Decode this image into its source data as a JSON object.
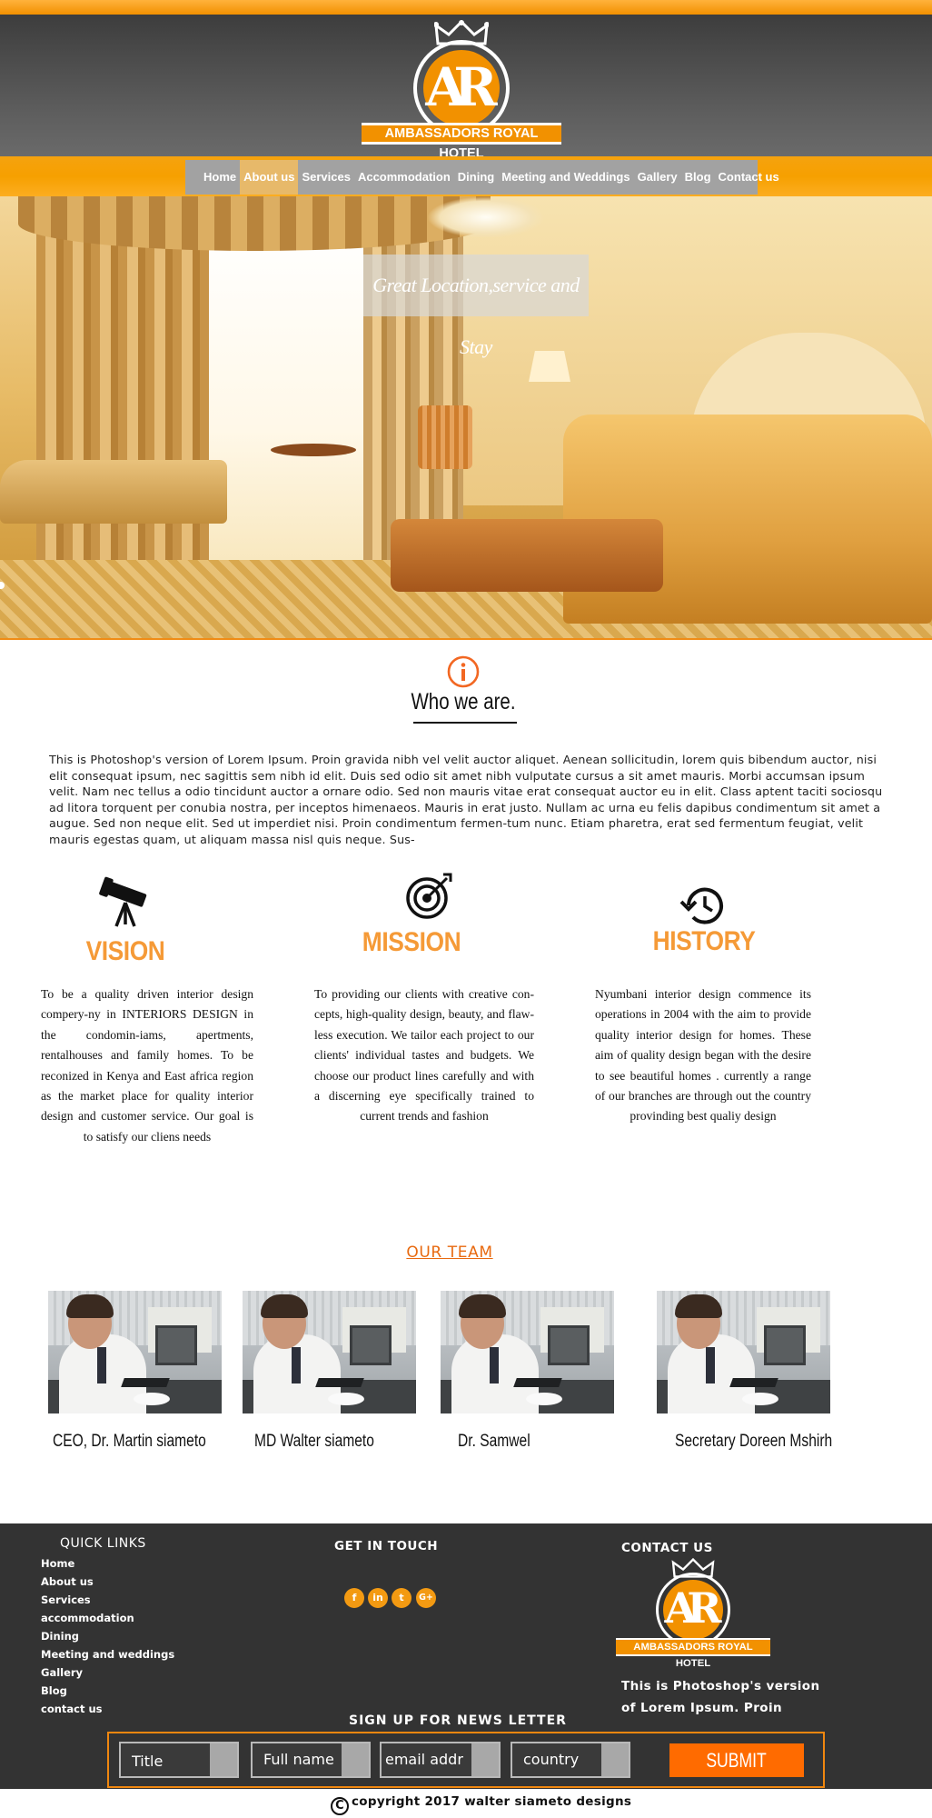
{
  "brand": {
    "monogram": "AR",
    "name": "AMBASSADORS ROYAL HOTEL",
    "accent_color": "#f29100",
    "icon": "crown-icon"
  },
  "nav": {
    "items": [
      {
        "label": "Home",
        "active": false
      },
      {
        "label": "About us",
        "active": true
      },
      {
        "label": "Services",
        "active": false
      },
      {
        "label": "Accommodation",
        "active": false
      },
      {
        "label": "Dining",
        "active": false
      },
      {
        "label": "Meeting and Weddings",
        "active": false
      },
      {
        "label": "Gallery",
        "active": false
      },
      {
        "label": "Blog",
        "active": false
      },
      {
        "label": "Contact us",
        "active": false
      }
    ]
  },
  "hero": {
    "caption": "Great Location,service and Stay"
  },
  "about": {
    "icon": "info-icon",
    "title": "Who we are.",
    "body": "This is Photoshop's version  of Lorem Ipsum. Proin gravida nibh vel velit auctor aliquet. Aenean sollicitudin, lorem quis bibendum auctor, nisi elit consequat ipsum, nec sagittis sem nibh id elit. Duis sed odio sit amet nibh vulputate cursus a sit amet mauris. Morbi accumsan ipsum velit. Nam nec tellus a odio tincidunt auctor a ornare odio. Sed non  mauris vitae erat consequat auctor eu in elit. Class aptent taciti sociosqu ad litora torquent per conubia nostra, per inceptos himenaeos. Mauris in erat justo. Nullam ac urna eu felis dapibus condimentum sit amet a augue. Sed non neque elit. Sed ut imperdiet nisi. Proin condimentum fermen-tum nunc. Etiam pharetra, erat sed fermentum feugiat, velit mauris egestas quam, ut aliquam massa nisl quis neque. Sus-"
  },
  "pillars": [
    {
      "icon": "telescope-icon",
      "title": "VISION",
      "text": "To be a quality driven interior design compery-ny in  INTERIORS DESIGN in the condomin-iams, apertments, rentalhouses and family homes. To be reconized in Kenya and East africa region as the market place for quality interior design and customer service. Our goal is to satisfy our cliens needs"
    },
    {
      "icon": "target-icon",
      "title": "MISSION",
      "text": "To providing our clients with creative con-cepts, high-quality design, beauty, and flaw-less execution. We tailor each project to our clients' individual tastes and budgets.  We choose our product lines carefully and with a discerning eye specifically trained to current trends and fashion"
    },
    {
      "icon": "history-icon",
      "title": "HISTORY",
      "text": "Nyumbani interior design commence its operations in 2004 with the aim to provide quality interior design for homes. These aim of quality design began with the desire to see beautiful homes . currently a range of our branches are through out the country provinding best qualiy design"
    }
  ],
  "team": {
    "title": "OUR TEAM",
    "members": [
      {
        "name": "CEO, Dr. Martin siameto"
      },
      {
        "name": "MD  Walter  siameto"
      },
      {
        "name": "Dr. Samwel"
      },
      {
        "name": "Secretary Doreen Mshirh"
      }
    ]
  },
  "footer": {
    "quick_links_title": "QUICK LINKS",
    "quick_links": [
      "Home",
      "About us",
      "Services",
      "accommodation",
      "Dining",
      "Meeting and weddings",
      "Gallery",
      "Blog",
      "contact us"
    ],
    "get_in_touch_title": "GET IN TOUCH",
    "social": [
      {
        "icon": "facebook-icon",
        "glyph": "f"
      },
      {
        "icon": "linkedin-icon",
        "glyph": "in"
      },
      {
        "icon": "twitter-icon",
        "glyph": "t"
      },
      {
        "icon": "google-plus-icon",
        "glyph": "G+"
      }
    ],
    "contact_title": "CONTACT US",
    "about_line1": "This is Photoshop's version",
    "about_line2": "of Lorem Ipsum. Proin",
    "newsletter_title": "SIGN UP FOR NEWS LETTER",
    "fields": {
      "title": "Title",
      "full_name": "Full name",
      "email": "email addr",
      "country": "country"
    },
    "submit_label": "SUBMIT",
    "copyright_symbol": "C",
    "copyright": "copyright 2017  walter siameto designs"
  }
}
